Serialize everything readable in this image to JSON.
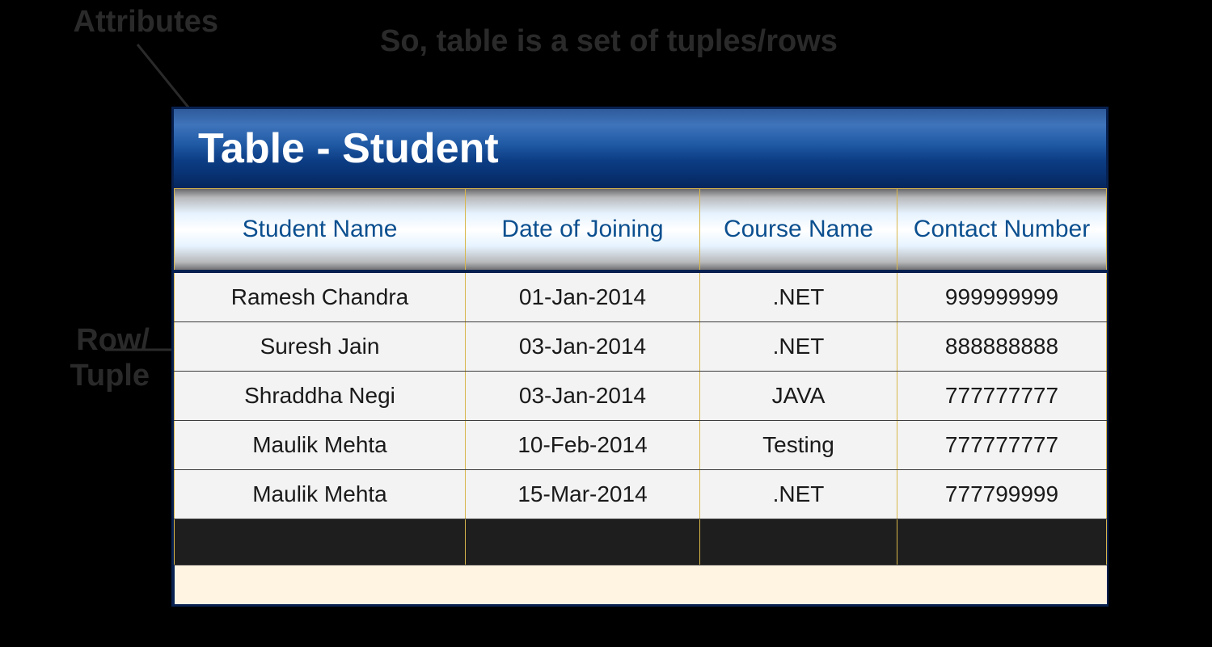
{
  "labels": {
    "attributes": "Attributes",
    "row_tuple_line1": "Row/",
    "row_tuple_line2": "Tuple"
  },
  "caption": "So, table is a set of tuples/rows",
  "title": "Table - Student",
  "columns": [
    "Student Name",
    "Date of Joining",
    "Course Name",
    "Contact Number"
  ],
  "rows": [
    {
      "name": "Ramesh Chandra",
      "doj": "01-Jan-2014",
      "course": ".NET",
      "contact": "999999999"
    },
    {
      "name": "Suresh Jain",
      "doj": "03-Jan-2014",
      "course": ".NET",
      "contact": "888888888"
    },
    {
      "name": "Shraddha Negi",
      "doj": "03-Jan-2014",
      "course": "JAVA",
      "contact": "777777777"
    },
    {
      "name": "Maulik Mehta",
      "doj": "10-Feb-2014",
      "course": "Testing",
      "contact": "777777777"
    },
    {
      "name": "Maulik Mehta",
      "doj": "15-Mar-2014",
      "course": ".NET",
      "contact": "777799999"
    }
  ]
}
